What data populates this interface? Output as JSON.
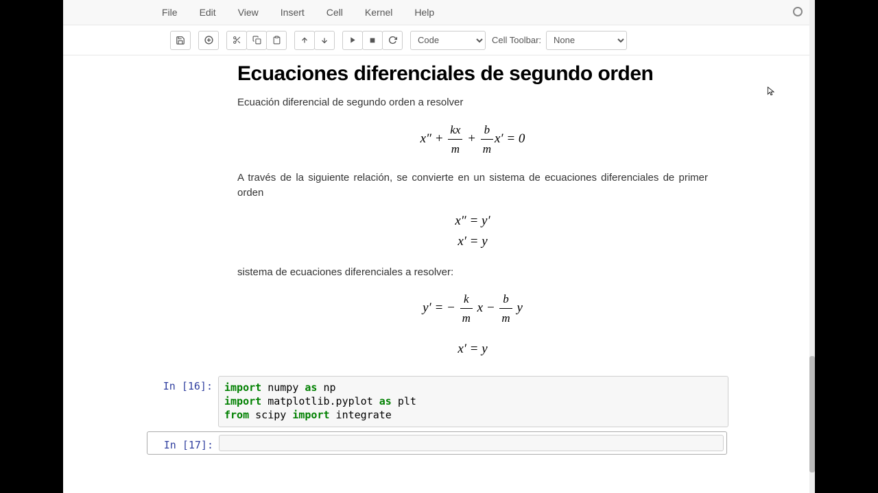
{
  "menu": {
    "file": "File",
    "edit": "Edit",
    "view": "View",
    "insert": "Insert",
    "cell": "Cell",
    "kernel": "Kernel",
    "help": "Help"
  },
  "toolbar": {
    "cell_type": "Code",
    "cell_toolbar_label": "Cell Toolbar:",
    "cell_toolbar_value": "None"
  },
  "markdown": {
    "title": "Ecuaciones diferenciales de segundo orden",
    "p1": "Ecuación diferencial de segundo orden a resolver",
    "p2": "A través de la siguiente relación, se convierte en un sistema de ecuaciones diferenciales de primer orden",
    "p3": "sistema de ecuaciones diferenciales a resolver:",
    "eq1": {
      "lhs_a": "x″",
      "frac1_num": "kx",
      "frac1_den": "m",
      "frac2_num": "b",
      "frac2_den": "m",
      "tail": "x′ = 0"
    },
    "eq2": {
      "line1": "x″ = y′",
      "line2": "x′ = y"
    },
    "eq3": {
      "lhs": "y′ = −",
      "f1_num": "k",
      "f1_den": "m",
      "mid1": "x −",
      "f2_num": "b",
      "f2_den": "m",
      "mid2": "y",
      "line2": "x′ = y"
    }
  },
  "cells": {
    "in16_label": "In [16]:",
    "in16_code": {
      "l1_kw1": "import",
      "l1_t1": " numpy ",
      "l1_kw2": "as",
      "l1_t2": " np",
      "l2_kw1": "import",
      "l2_t1": " matplotlib.pyplot ",
      "l2_kw2": "as",
      "l2_t2": " plt",
      "l3_kw1": "from",
      "l3_t1": " scipy ",
      "l3_kw2": "import",
      "l3_t2": " integrate"
    },
    "in17_label": "In [17]:"
  }
}
